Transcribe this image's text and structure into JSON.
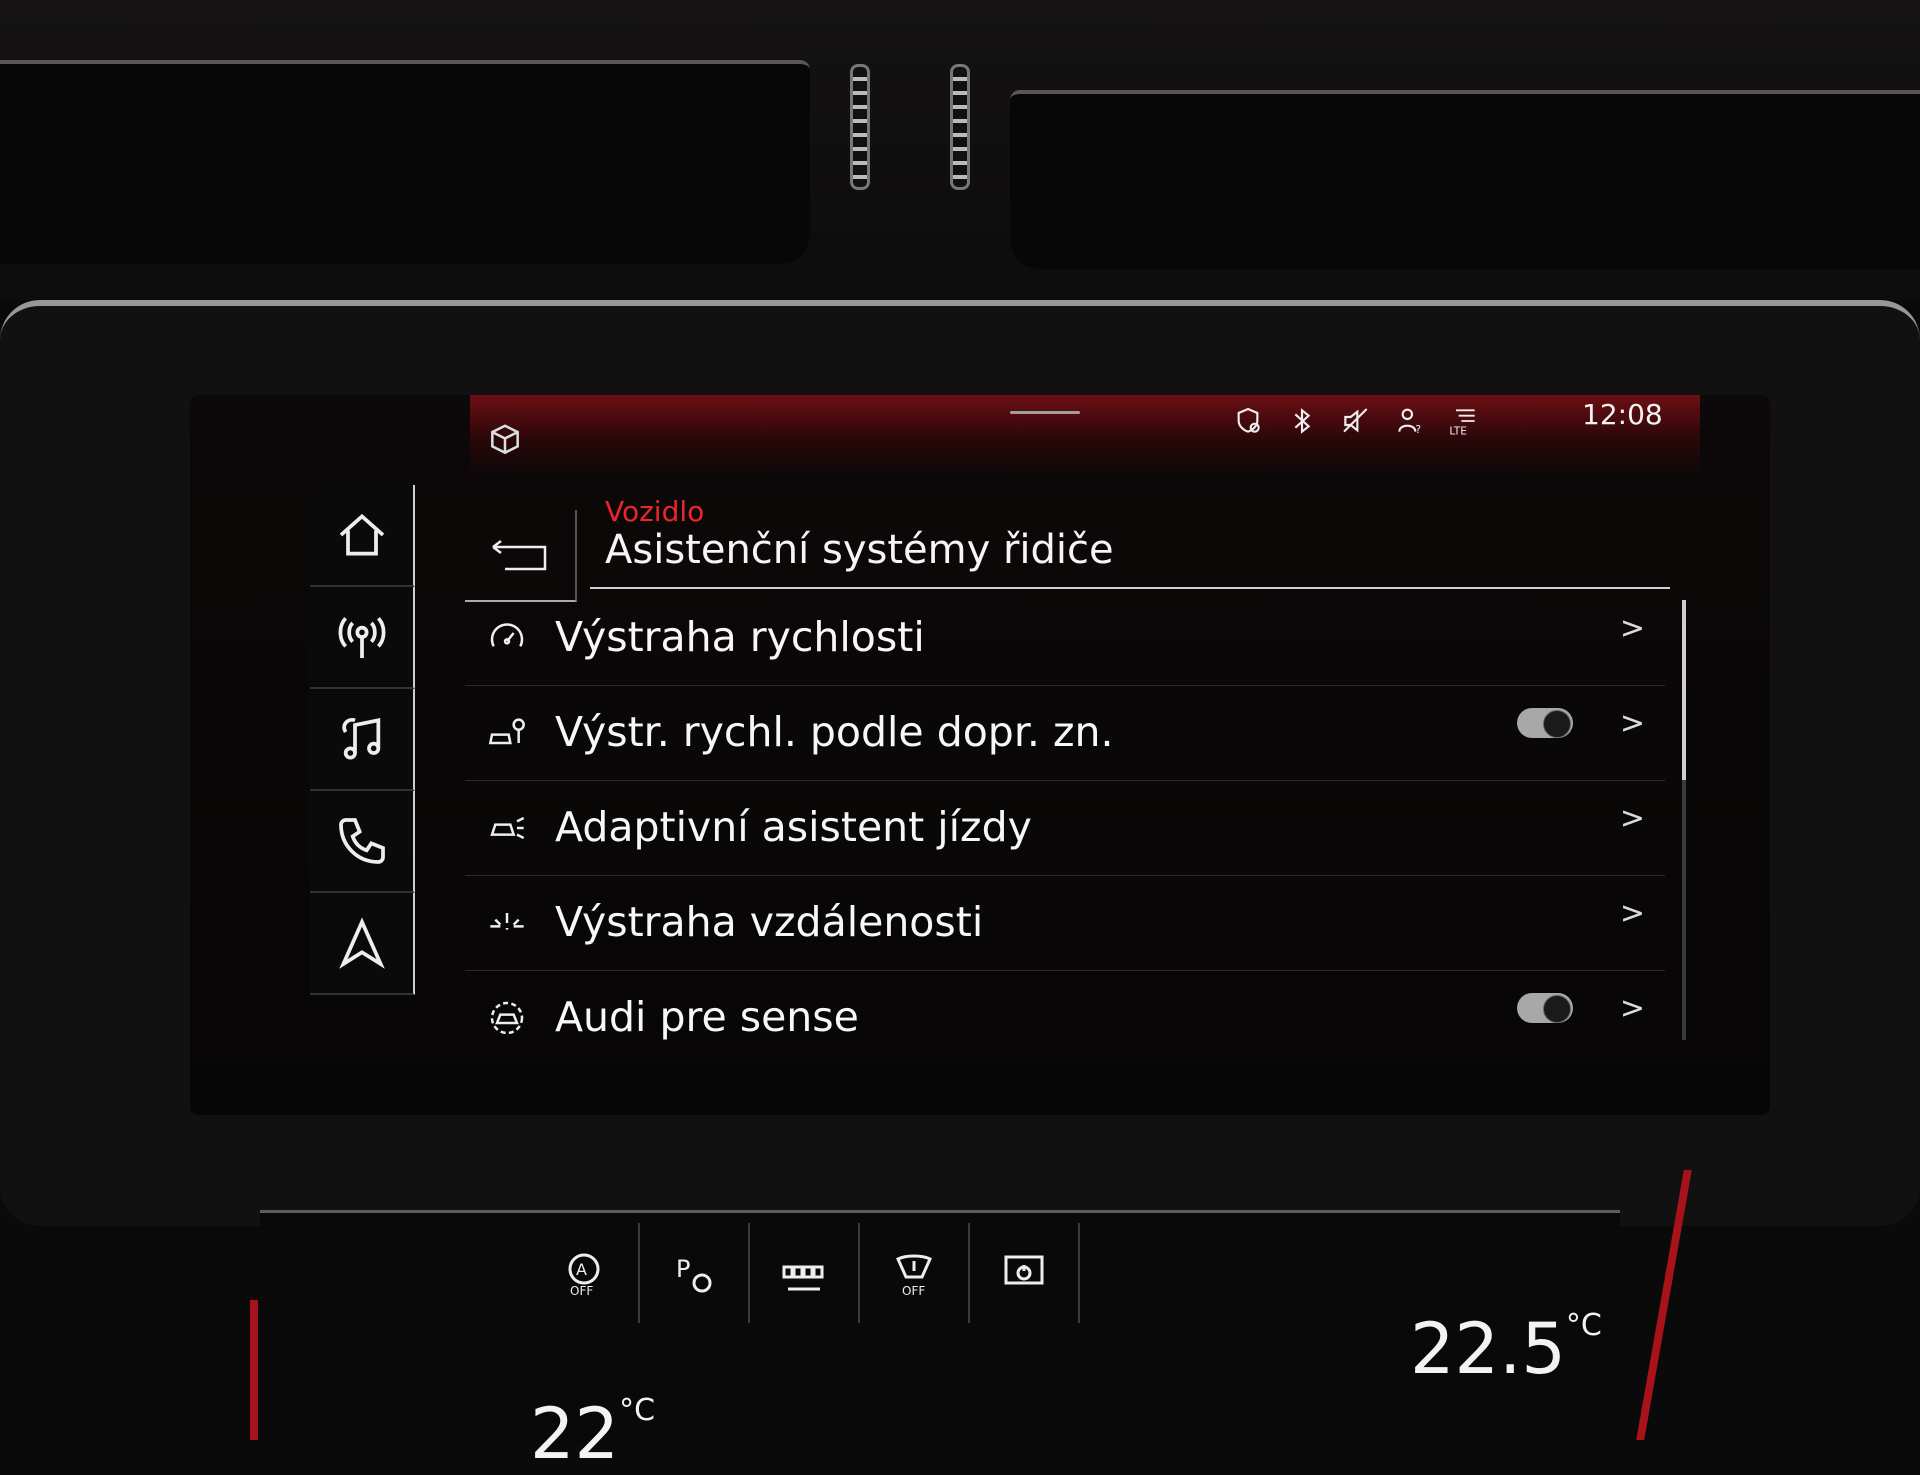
{
  "status_bar": {
    "time": "12:08",
    "icons": [
      "location-shield-icon",
      "bluetooth-icon",
      "mute-icon",
      "user-help-icon",
      "lte-icon"
    ],
    "lte_label": "LTE"
  },
  "header": {
    "breadcrumb": "Vozidlo",
    "title": "Asistenční systémy řidiče",
    "accent_color": "#e8262e"
  },
  "nav": {
    "items": [
      {
        "icon": "home-icon"
      },
      {
        "icon": "radio-icon"
      },
      {
        "icon": "music-icon"
      },
      {
        "icon": "phone-icon"
      },
      {
        "icon": "navigation-icon"
      }
    ]
  },
  "list": {
    "items": [
      {
        "label": "Výstraha rychlosti",
        "icon": "speedometer-icon",
        "toggle": false
      },
      {
        "label": "Výstr. rychl. podle dopr. zn.",
        "icon": "traffic-sign-car-icon",
        "toggle": true,
        "toggle_on": true
      },
      {
        "label": "Adaptivní asistent jízdy",
        "icon": "driver-assist-icon",
        "toggle": false
      },
      {
        "label": "Výstraha vzdálenosti",
        "icon": "distance-warning-icon",
        "toggle": false
      },
      {
        "label": "Audi pre sense",
        "icon": "pre-sense-icon",
        "toggle": true,
        "toggle_on": true
      }
    ]
  },
  "climate": {
    "temp_right": "22.5",
    "unit": "°C",
    "temp_left": "22",
    "buttons": [
      {
        "icon": "auto-start-stop-off-icon",
        "label": "OFF"
      },
      {
        "icon": "parking-icon",
        "label": "P"
      },
      {
        "icon": "seat-heat-icon"
      },
      {
        "icon": "traction-off-icon",
        "label": "OFF"
      },
      {
        "icon": "display-off-icon"
      }
    ]
  }
}
